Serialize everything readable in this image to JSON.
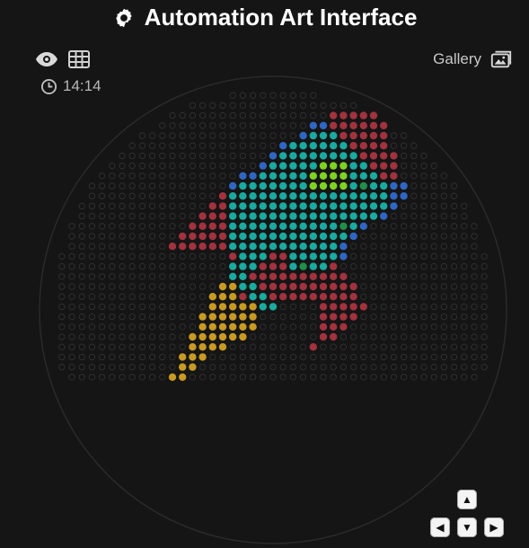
{
  "header": {
    "title": "Automation Art Interface",
    "logo_icon": "gear-icon"
  },
  "toolbar": {
    "view_icon": "eye-icon",
    "grid_icon": "grid-icon",
    "time": "14:14",
    "clock_icon": "clock-icon"
  },
  "gallery": {
    "label": "Gallery",
    "icon": "image-gallery-icon"
  },
  "palette": {
    "background": "#151515",
    "empty_dot": "#2f2f2f",
    "red": "#a2323e",
    "teal": "#19aaa0",
    "blue": "#2f66c4",
    "green": "#1f8f4a",
    "lime": "#7ed321",
    "yellow": "#c89a22"
  },
  "dot_art": {
    "rows": [
      "...............................................",
      "...............................................",
      ".................................R.............",
      ".............................RRRRRRR...........",
      "...........................BBRRRRRRR...........",
      "..........................BTTTRRRRR...........",
      "........................BTTTTTTRRRR...........",
      ".......................BTTTTTTTTRRRR...........",
      "......................BTTTTTLLLTTRRR...........",
      "....................BBTTTTTLLLLTTTRR..........",
      "...................BTTTTTTTLLLLTGTTBB.........",
      "..................RTTTTTTTTTTTTTTTTBB.........",
      ".................RRTTTTTTTTTTTTTTTTB..........",
      "................RRRTTTTTTTTTTTTTTTB...........",
      "...............RRRRTTTTTTTTTTTGTB.............",
      "..............RRRRRTTTTTTTTTTTTB..............",
      ".............RRRRRRTTTTTTTTTTTB...............",
      "...................RTTTRRTTTTTB...............",
      "...................TTTRRRTGTTR................",
      "...................TTRRRRRRRRRR...............",
      "..................YYTTRRRRRRRRRR..............",
      ".................YYYRTTRRRRRRRRR..............",
      ".................YYYYYTT....RRRRR.............",
      "................YYYYYY......RRRR..............",
      "................YYYYYY......RRR...............",
      "...............YYYYYY.......RR................",
      "...............YYYY........R..................",
      "..............YYY.............................",
      "..............YY..............................",
      ".............YY..............................."
    ]
  },
  "controls": {
    "up_label": "▲",
    "left_label": "◀",
    "down_label": "▼",
    "right_label": "▶"
  }
}
